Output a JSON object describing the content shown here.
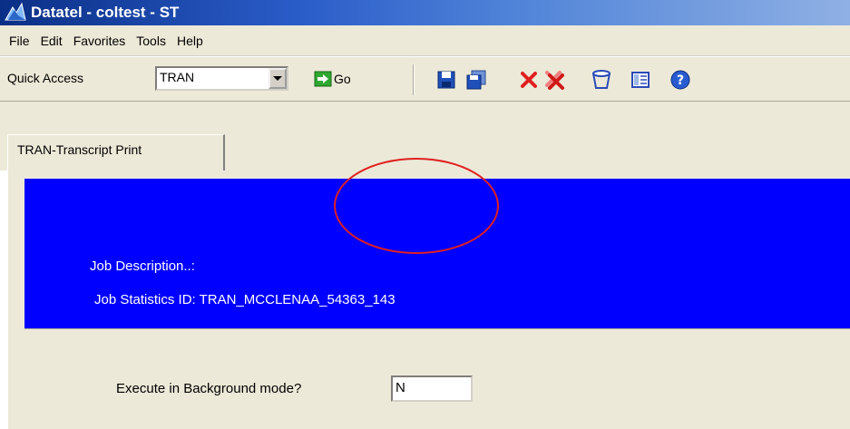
{
  "window": {
    "title": "Datatel - coltest - ST"
  },
  "menu": [
    "File",
    "Edit",
    "Favorites",
    "Tools",
    "Help"
  ],
  "toolbar": {
    "quick_access_label": "Quick Access",
    "quick_access_value": "TRAN",
    "go_label": "Go",
    "icons": [
      "save-icon",
      "save-all-icon",
      "cancel-icon",
      "cancel-all-icon",
      "delete-icon",
      "document-icon",
      "help-icon"
    ]
  },
  "tab": {
    "label": "TRAN-Transcript Print"
  },
  "banner": {
    "job_description_label": "Job Description..:",
    "job_statistics_label": "Job Statistics ID:",
    "job_statistics_value": "TRAN_MCCLENAA_54363_143",
    "color": "#0000ff"
  },
  "form": {
    "background_mode_label": "Execute in Background mode?",
    "background_mode_value": "N"
  },
  "annotation": {
    "color": "#e02020"
  }
}
